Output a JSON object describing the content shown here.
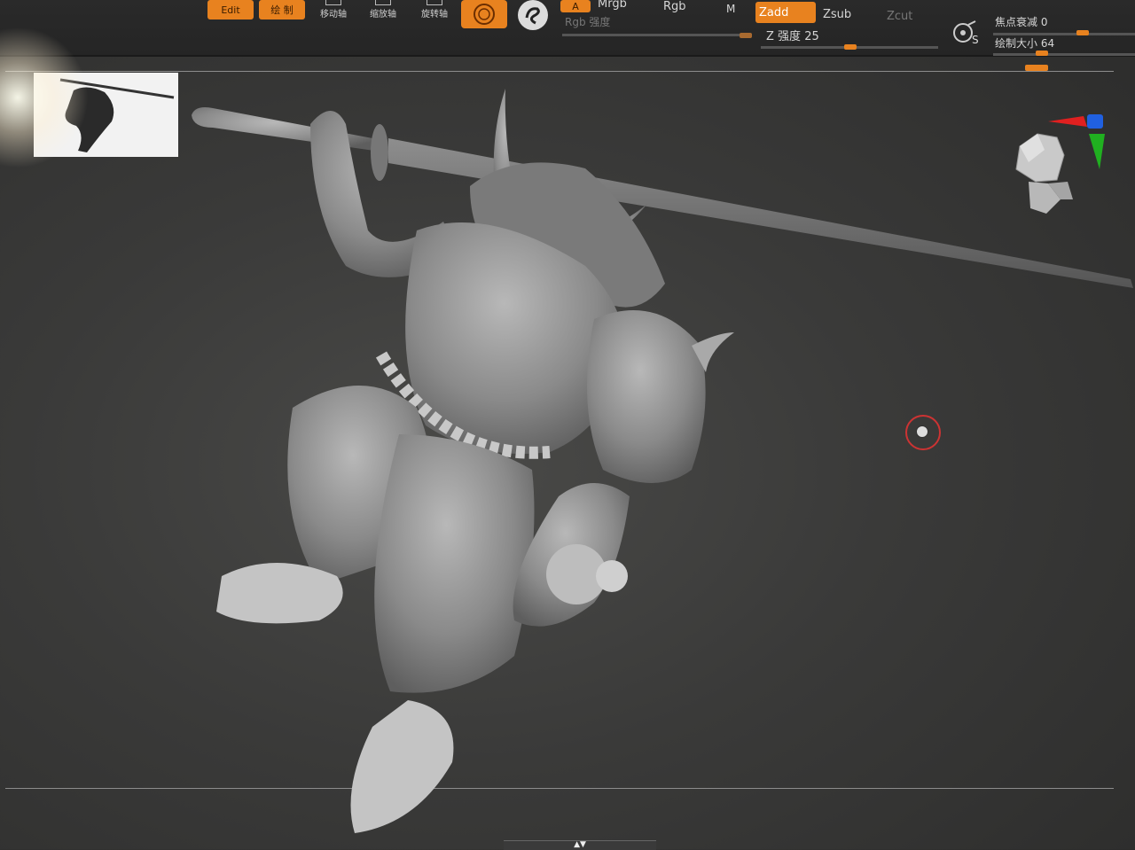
{
  "toolbar": {
    "edit_label": "Edit",
    "draw_label": "绘 制",
    "move_label": "移动轴",
    "scale_label": "缩放轴",
    "rotate_label": "旋转轴",
    "a_label": "A",
    "mrgb_label": "Mrgb",
    "rgb_label": "Rgb",
    "m_label": "M",
    "rgb_intensity_label": "Rgb 强度",
    "zadd_label": "Zadd",
    "zsub_label": "Zsub",
    "zcut_label": "Zcut",
    "z_intensity_label": "Z 强度",
    "z_intensity_value": "25",
    "focal_shift_label": "焦点衰减",
    "focal_shift_value": "0",
    "draw_size_label": "绘制大小",
    "draw_size_value": "64",
    "s_label": "S"
  },
  "colors": {
    "accent": "#e8821f",
    "background": "#3a3a39",
    "axis_x": "#e02020",
    "axis_y": "#20b020",
    "axis_z": "#2060e0",
    "cursor_ring": "#cc3333"
  },
  "icons": {
    "brush": "brush-circle-icon",
    "stroke": "stroke-swirl-icon",
    "lazy_mouse": "lazy-mouse-s-icon",
    "nav_head": "navigation-head-icon",
    "axis": "axis-gizmo-icon",
    "cursor": "brush-cursor-icon",
    "collapse": "collapse-arrows-icon"
  }
}
